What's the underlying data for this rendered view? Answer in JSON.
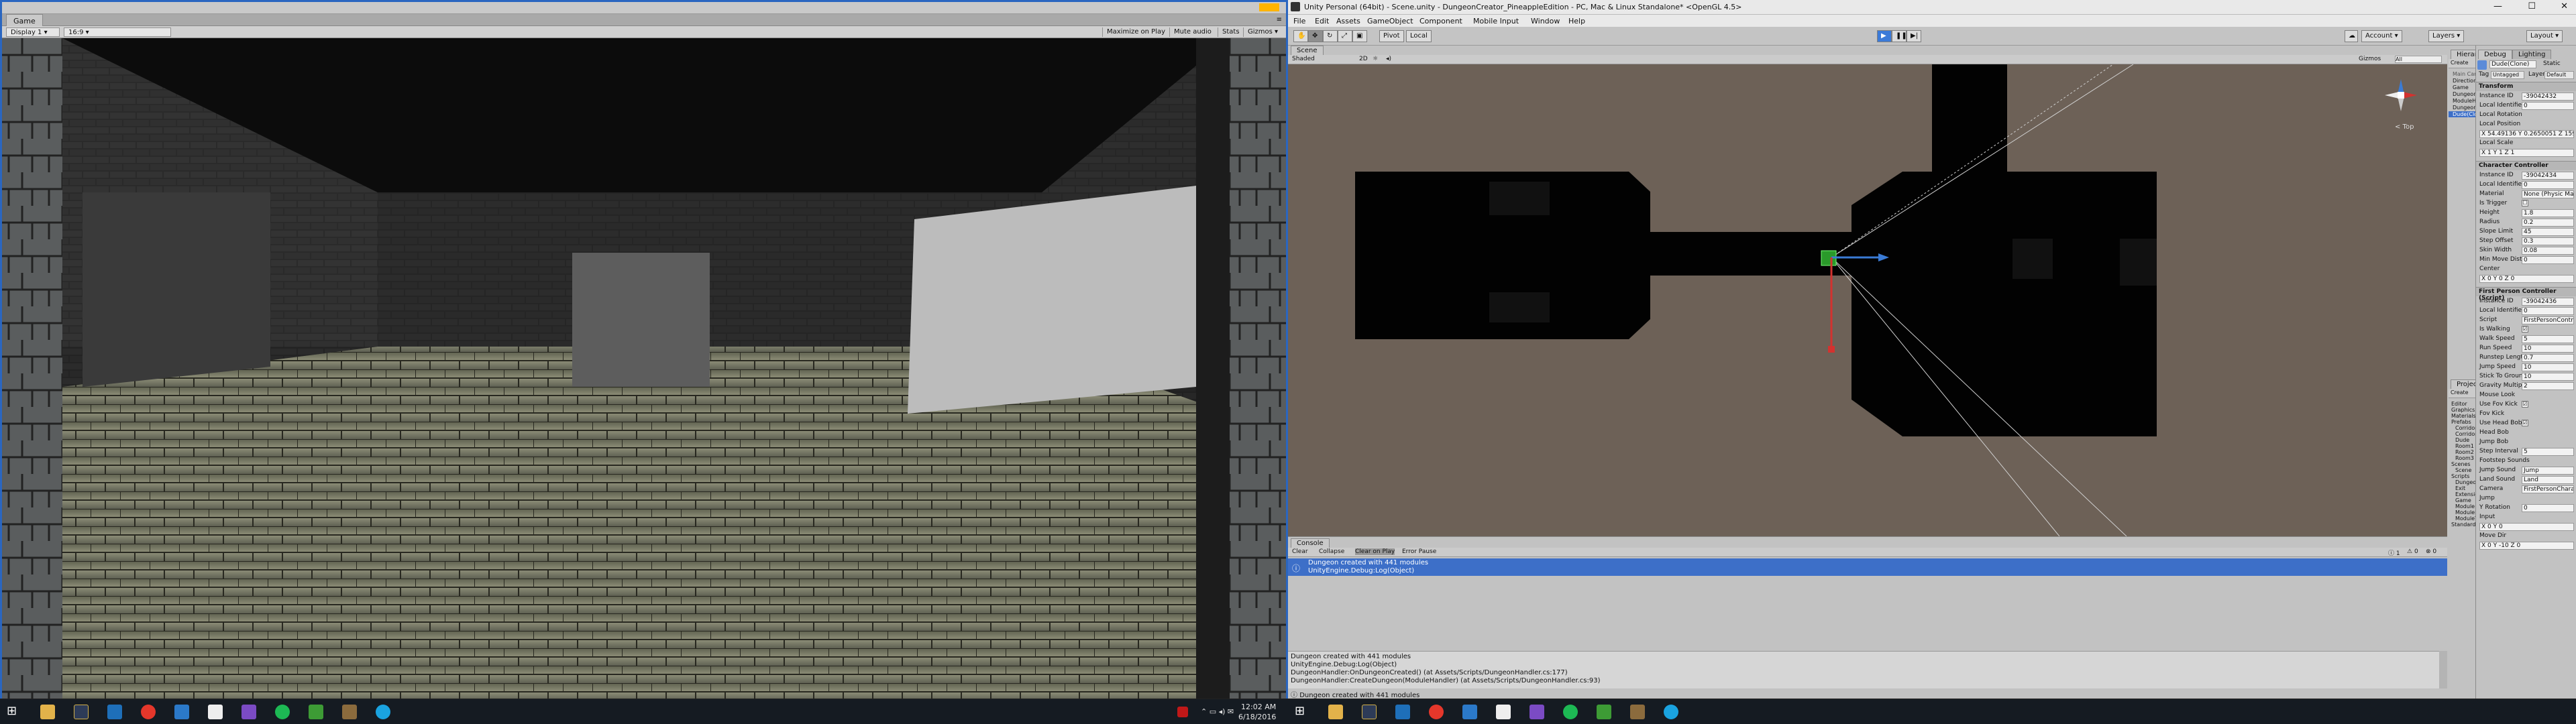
{
  "game": {
    "tab": "Game",
    "display": "Display 1",
    "aspect": "16:9",
    "maximize_on_play": "Maximize on Play",
    "mute_audio": "Mute audio",
    "stats": "Stats",
    "gizmos": "Gizmos"
  },
  "editor": {
    "title": "Unity Personal (64bit) - Scene.unity - DungeonCreator_PineappleEdition - PC, Mac & Linux Standalone* <OpenGL 4.5>",
    "menu": [
      "File",
      "Edit",
      "Assets",
      "GameObject",
      "Component",
      "Mobile Input",
      "Window",
      "Help"
    ],
    "toolbar": {
      "pivot": "Pivot",
      "local": "Local",
      "account": "Account",
      "layers": "Layers",
      "layout": "Layout"
    },
    "scene": {
      "tab": "Scene",
      "shaded": "Shaded",
      "mode2d": "2D",
      "gizmos": "Gizmos",
      "search": "All",
      "persp": "< Top"
    },
    "console": {
      "tab": "Console",
      "buttons": [
        "Clear",
        "Collapse",
        "Clear on Play",
        "Error Pause"
      ],
      "counts": [
        "1",
        "0",
        "0"
      ],
      "selected_lines": [
        "Dungeon created with 441 modules",
        "UnityEngine.Debug:Log(Object)"
      ],
      "detail": [
        "Dungeon created with 441 modules",
        "UnityEngine.Debug:Log(Object)",
        "DungeonHandler:OnDungeonCreated() (at Assets/Scripts/DungeonHandler.cs:177)",
        "DungeonHandler:CreateDungeon(ModuleHandler) (at Assets/Scripts/DungeonHandler.cs:93)"
      ],
      "status": "Dungeon created with 441 modules"
    },
    "hierarchy": {
      "tab": "Hierarchy",
      "create": "Create",
      "search": "All",
      "items": [
        "Main Camera",
        "Directional Light",
        "Game",
        "DungeonHandler",
        "ModuleHandler",
        "Dungeon",
        "Dude(Clone)"
      ]
    },
    "project": {
      "tab": "Project",
      "create": "Create",
      "tree": [
        {
          "label": "Editor",
          "indent": 0
        },
        {
          "label": "Graphics",
          "indent": 0
        },
        {
          "label": "Materials",
          "indent": 0
        },
        {
          "label": "Prefabs",
          "indent": 0
        },
        {
          "label": "Corridor1",
          "indent": 1
        },
        {
          "label": "Corridor2",
          "indent": 1
        },
        {
          "label": "Dude",
          "indent": 1
        },
        {
          "label": "Room1",
          "indent": 1
        },
        {
          "label": "Room2",
          "indent": 1
        },
        {
          "label": "Room3",
          "indent": 1
        },
        {
          "label": "Scenes",
          "indent": 0
        },
        {
          "label": "Scene",
          "indent": 1
        },
        {
          "label": "Scripts",
          "indent": 0
        },
        {
          "label": "DungeonHandler",
          "indent": 1
        },
        {
          "label": "Exit",
          "indent": 1
        },
        {
          "label": "Extensions",
          "indent": 1
        },
        {
          "label": "Game",
          "indent": 1
        },
        {
          "label": "Module",
          "indent": 1
        },
        {
          "label": "ModuleHandler",
          "indent": 1
        },
        {
          "label": "ModuleType",
          "indent": 1
        },
        {
          "label": "Standard Assets",
          "indent": 0
        }
      ]
    },
    "inspector": {
      "tabs": [
        "Debug",
        "Lighting"
      ],
      "object_name": "Dude(Clone)",
      "static": "Static",
      "tag_label": "Tag",
      "tag": "Untagged",
      "layer_label": "Layer",
      "layer": "Default",
      "sections": [
        {
          "title": "Transform",
          "rows": [
            [
              "Instance ID",
              "-39042432"
            ],
            [
              "Local Identifier In File",
              "0"
            ],
            [
              "Local Rotation",
              ""
            ],
            [
              "Local Position",
              ""
            ],
            [
              "",
              "X 54.49136  Y 0.2650051  Z 159.4874"
            ],
            [
              "Local Scale",
              ""
            ],
            [
              "",
              "X 1   Y 1   Z 1"
            ]
          ]
        },
        {
          "title": "Character Controller",
          "rows": [
            [
              "Instance ID",
              "-39042434"
            ],
            [
              "Local Identifier In File",
              "0"
            ],
            [
              "Material",
              "None (Physic Material)"
            ],
            [
              "Is Trigger",
              "☐"
            ],
            [
              "Height",
              "1.8"
            ],
            [
              "Radius",
              "0.2"
            ],
            [
              "Slope Limit",
              "45"
            ],
            [
              "Step Offset",
              "0.3"
            ],
            [
              "Skin Width",
              "0.08"
            ],
            [
              "Min Move Distance",
              "0"
            ],
            [
              "Center",
              ""
            ],
            [
              "",
              "X 0   Y 0   Z 0"
            ]
          ]
        },
        {
          "title": "First Person Controller (Script)",
          "rows": [
            [
              "Instance ID",
              "-39042436"
            ],
            [
              "Local Identifier In File",
              "0"
            ],
            [
              "Script",
              "FirstPersonController"
            ],
            [
              "Is Walking",
              "☑"
            ],
            [
              "Walk Speed",
              "5"
            ],
            [
              "Run Speed",
              "10"
            ],
            [
              "Runstep Lengthen",
              "0.7"
            ],
            [
              "Jump Speed",
              "10"
            ],
            [
              "Stick To Ground Force",
              "10"
            ],
            [
              "Gravity Multiplier",
              "2"
            ],
            [
              "Mouse Look",
              ""
            ],
            [
              "Use Fov Kick",
              "☑"
            ],
            [
              "Fov Kick",
              ""
            ],
            [
              "Use Head Bob",
              "☑"
            ],
            [
              "Head Bob",
              ""
            ],
            [
              "Jump Bob",
              ""
            ],
            [
              "Step Interval",
              "5"
            ],
            [
              "Footstep Sounds",
              ""
            ],
            [
              "Jump Sound",
              "Jump"
            ],
            [
              "Land Sound",
              "Land"
            ],
            [
              "Camera",
              "FirstPersonCharacter"
            ],
            [
              "Jump",
              ""
            ],
            [
              "Y Rotation",
              "0"
            ],
            [
              "Input",
              ""
            ],
            [
              "",
              "X 0   Y 0"
            ],
            [
              "Move Dir",
              ""
            ],
            [
              "",
              "X 0   Y -10   Z 0"
            ]
          ]
        }
      ]
    }
  },
  "taskbar": {
    "clock_time": "12:02 AM",
    "clock_date": "6/18/2016"
  }
}
